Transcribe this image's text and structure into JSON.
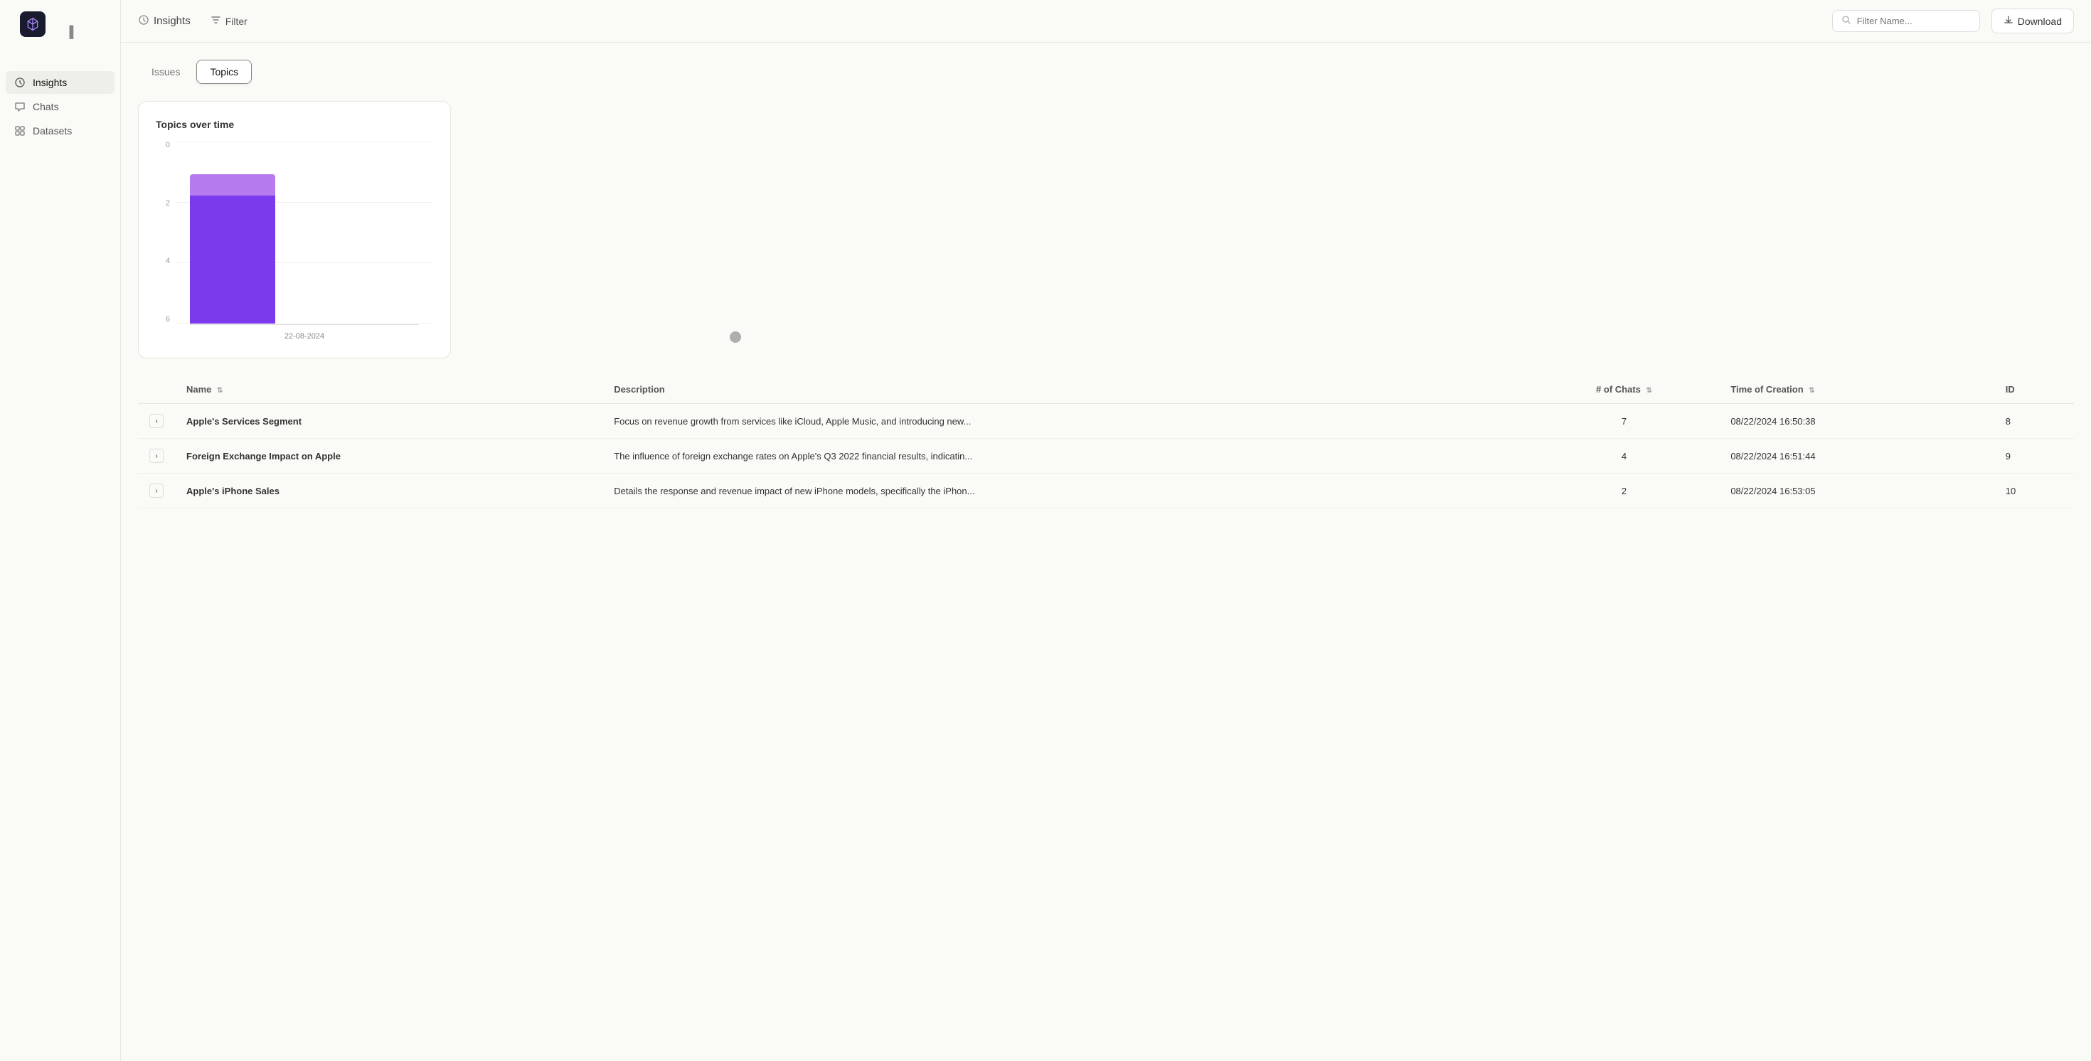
{
  "app": {
    "logo_alt": "App Logo"
  },
  "topbar": {
    "insights_label": "Insights",
    "filter_label": "Filter",
    "filter_placeholder": "Filter Name...",
    "download_label": "Download"
  },
  "sidebar": {
    "items": [
      {
        "id": "insights",
        "label": "Insights",
        "active": true
      },
      {
        "id": "chats",
        "label": "Chats",
        "active": false
      },
      {
        "id": "datasets",
        "label": "Datasets",
        "active": false
      }
    ]
  },
  "tabs": [
    {
      "id": "issues",
      "label": "Issues",
      "active": false
    },
    {
      "id": "topics",
      "label": "Topics",
      "active": true
    }
  ],
  "chart": {
    "title": "Topics over time",
    "y_labels": [
      "6",
      "4",
      "2",
      "0"
    ],
    "bar": {
      "top_height_pct": 14,
      "bottom_height_pct": 75,
      "top_color": "#b57bee",
      "bottom_color": "#7c3aed"
    },
    "x_label": "22-08-2024"
  },
  "table": {
    "columns": [
      {
        "id": "expand",
        "label": ""
      },
      {
        "id": "name",
        "label": "Name"
      },
      {
        "id": "description",
        "label": "Description"
      },
      {
        "id": "chats",
        "label": "# of Chats"
      },
      {
        "id": "time",
        "label": "Time of Creation"
      },
      {
        "id": "id",
        "label": "ID"
      }
    ],
    "rows": [
      {
        "name": "Apple's Services Segment",
        "description": "Focus on revenue growth from services like iCloud, Apple Music, and introducing new...",
        "chats": "7",
        "time": "08/22/2024 16:50:38",
        "id": "8"
      },
      {
        "name": "Foreign Exchange Impact on Apple",
        "description": "The influence of foreign exchange rates on Apple's Q3 2022 financial results, indicatin...",
        "chats": "4",
        "time": "08/22/2024 16:51:44",
        "id": "9"
      },
      {
        "name": "Apple's iPhone Sales",
        "description": "Details the response and revenue impact of new iPhone models, specifically the iPhon...",
        "chats": "2",
        "time": "08/22/2024 16:53:05",
        "id": "10"
      }
    ]
  }
}
